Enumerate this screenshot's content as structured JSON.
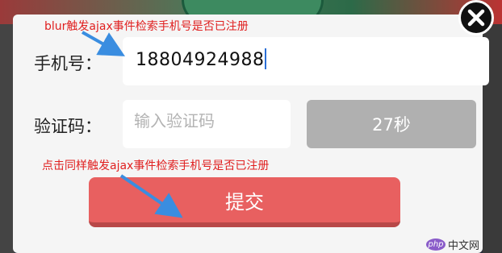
{
  "form": {
    "phone_label": "手机号：",
    "phone_value": "18804924988",
    "code_label": "验证码：",
    "code_placeholder": "输入验证码",
    "countdown_label": "27秒",
    "submit_label": "提交"
  },
  "annotations": {
    "top_note": "blur触发ajax事件检索手机号是否已注册",
    "bottom_note": "点击同样触发ajax事件检索手机号是否已注册"
  },
  "watermark": {
    "logo_text": "php",
    "site_text": "中文网"
  },
  "colors": {
    "submit_bg": "#e86060",
    "countdown_bg": "#b0b0b0",
    "annotation": "#e02020",
    "arrow": "#3a8de0"
  },
  "icons": {
    "close": "close-icon"
  }
}
